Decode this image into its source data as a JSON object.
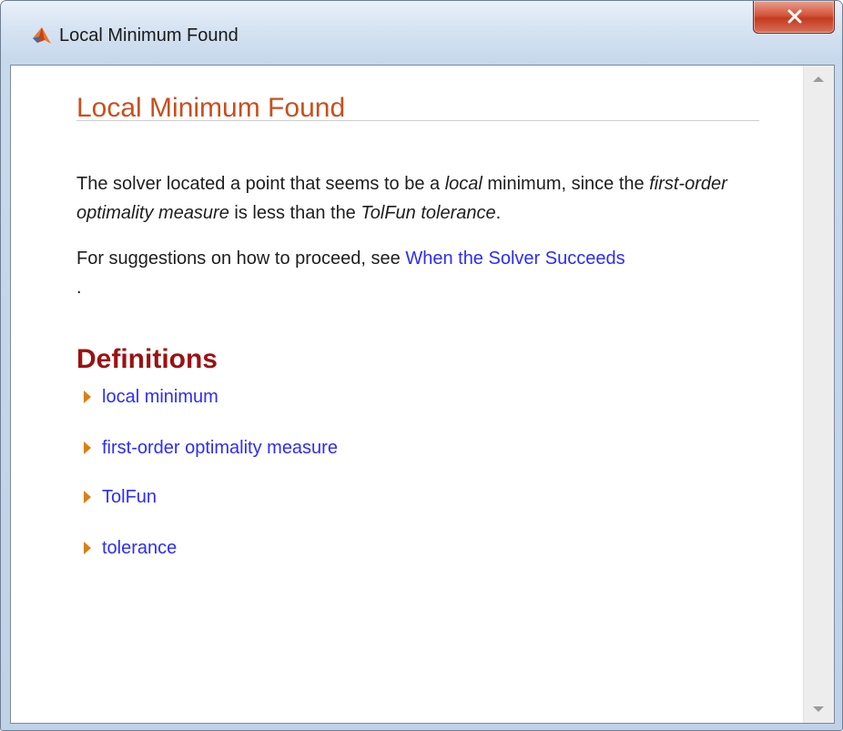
{
  "window": {
    "title": "Local Minimum Found",
    "icon": "matlab-icon",
    "close_icon": "close-icon"
  },
  "content": {
    "heading": "Local Minimum Found",
    "para1": {
      "pre": "The solver located a point that seems to be a ",
      "em1": "local",
      "mid1": " minimum, since the ",
      "em2": "first-order optimality measure",
      "mid2": " is less than the ",
      "em3": "TolFun tolerance",
      "post": "."
    },
    "para2": {
      "text": "For suggestions on how to proceed, see ",
      "link": "When the Solver Succeeds",
      "post": "."
    },
    "definitions": {
      "title": "Definitions",
      "items": [
        {
          "label": "local minimum"
        },
        {
          "label": "first-order optimality measure"
        },
        {
          "label": "TolFun"
        },
        {
          "label": "tolerance"
        }
      ]
    }
  },
  "colors": {
    "heading": "#c7501e",
    "section": "#9a1212",
    "link": "#2c2cff",
    "disclosure": "#e07d10"
  }
}
